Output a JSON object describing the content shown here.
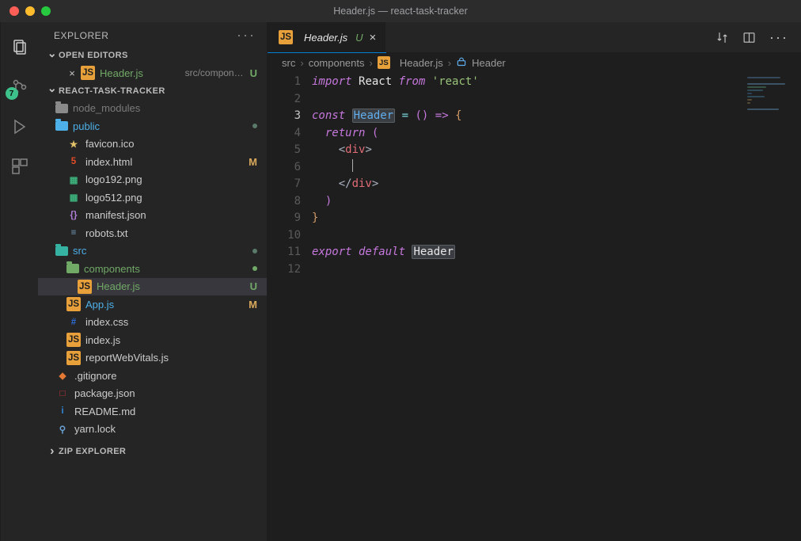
{
  "window": {
    "title": "Header.js — react-task-tracker"
  },
  "scm_badge": 7,
  "explorer": {
    "title": "EXPLORER",
    "open_editors_label": "OPEN EDITORS",
    "project_label": "REACT-TASK-TRACKER",
    "zip_label": "ZIP EXPLORER",
    "open_editor": {
      "name": "Header.js",
      "path": "src/compon…",
      "status": "U"
    },
    "tree": [
      {
        "kind": "folder",
        "icon": "dim",
        "name": "node_modules",
        "depth": 0,
        "dim": true
      },
      {
        "kind": "folder",
        "icon": "cyan",
        "name": "public",
        "depth": 0,
        "blue": true,
        "dot": true
      },
      {
        "kind": "file",
        "name": "favicon.ico",
        "depth": 1,
        "iconColor": "#e2c36a",
        "iconGlyph": "★"
      },
      {
        "kind": "file",
        "name": "index.html",
        "depth": 1,
        "iconColor": "#e44d26",
        "iconGlyph": "5",
        "status": "M"
      },
      {
        "kind": "file",
        "name": "logo192.png",
        "depth": 1,
        "iconColor": "#3cb07b",
        "iconGlyph": "▦"
      },
      {
        "kind": "file",
        "name": "logo512.png",
        "depth": 1,
        "iconColor": "#3cb07b",
        "iconGlyph": "▦"
      },
      {
        "kind": "file",
        "name": "manifest.json",
        "depth": 1,
        "iconColor": "#b07dd6",
        "iconGlyph": "{}"
      },
      {
        "kind": "file",
        "name": "robots.txt",
        "depth": 1,
        "iconColor": "#7aa7c7",
        "iconGlyph": "≡"
      },
      {
        "kind": "folder",
        "icon": "teal",
        "name": "src",
        "depth": 0,
        "blue": true,
        "dot": true
      },
      {
        "kind": "folder",
        "icon": "green",
        "name": "components",
        "depth": 1,
        "untracked": true,
        "dotGreen": true
      },
      {
        "kind": "file",
        "name": "Header.js",
        "depth": 2,
        "js": true,
        "untracked": true,
        "status": "U",
        "selected": true
      },
      {
        "kind": "file",
        "name": "App.js",
        "depth": 1,
        "js": true,
        "blue": true,
        "status": "M"
      },
      {
        "kind": "file",
        "name": "index.css",
        "depth": 1,
        "iconColor": "#2e6bd6",
        "iconGlyph": "#"
      },
      {
        "kind": "file",
        "name": "index.js",
        "depth": 1,
        "js": true
      },
      {
        "kind": "file",
        "name": "reportWebVitals.js",
        "depth": 1,
        "js": true
      },
      {
        "kind": "file",
        "name": ".gitignore",
        "depth": 0,
        "iconColor": "#e37933",
        "iconGlyph": "◆"
      },
      {
        "kind": "file",
        "name": "package.json",
        "depth": 0,
        "iconColor": "#cb3837",
        "iconGlyph": "□"
      },
      {
        "kind": "file",
        "name": "README.md",
        "depth": 0,
        "iconColor": "#2f86d6",
        "iconGlyph": "i"
      },
      {
        "kind": "file",
        "name": "yarn.lock",
        "depth": 0,
        "iconColor": "#6aa2d8",
        "iconGlyph": "⚲"
      }
    ]
  },
  "tab": {
    "name": "Header.js",
    "status": "U"
  },
  "breadcrumb": {
    "a": "src",
    "b": "components",
    "c": "Header.js",
    "d": "Header"
  },
  "code": {
    "lines": [
      1,
      2,
      3,
      4,
      5,
      6,
      7,
      8,
      9,
      10,
      11,
      12
    ],
    "current": 3,
    "l1": {
      "kw": "import",
      "v": "React",
      "from": "from",
      "str": "'react'"
    },
    "l3": {
      "kw": "const",
      "name": "Header",
      "arrow": "=>",
      "eq": "=",
      "paren": "()",
      "brace": "{"
    },
    "l4": {
      "kw": "return",
      "paren": "("
    },
    "l5": {
      "open": "<",
      "tag": "div",
      "close": ">"
    },
    "l7": {
      "open": "</",
      "tag": "div",
      "close": ">"
    },
    "l8": {
      "paren": ")"
    },
    "l9": {
      "brace": "}"
    },
    "l11": {
      "kw": "export default",
      "name": "Header"
    }
  }
}
